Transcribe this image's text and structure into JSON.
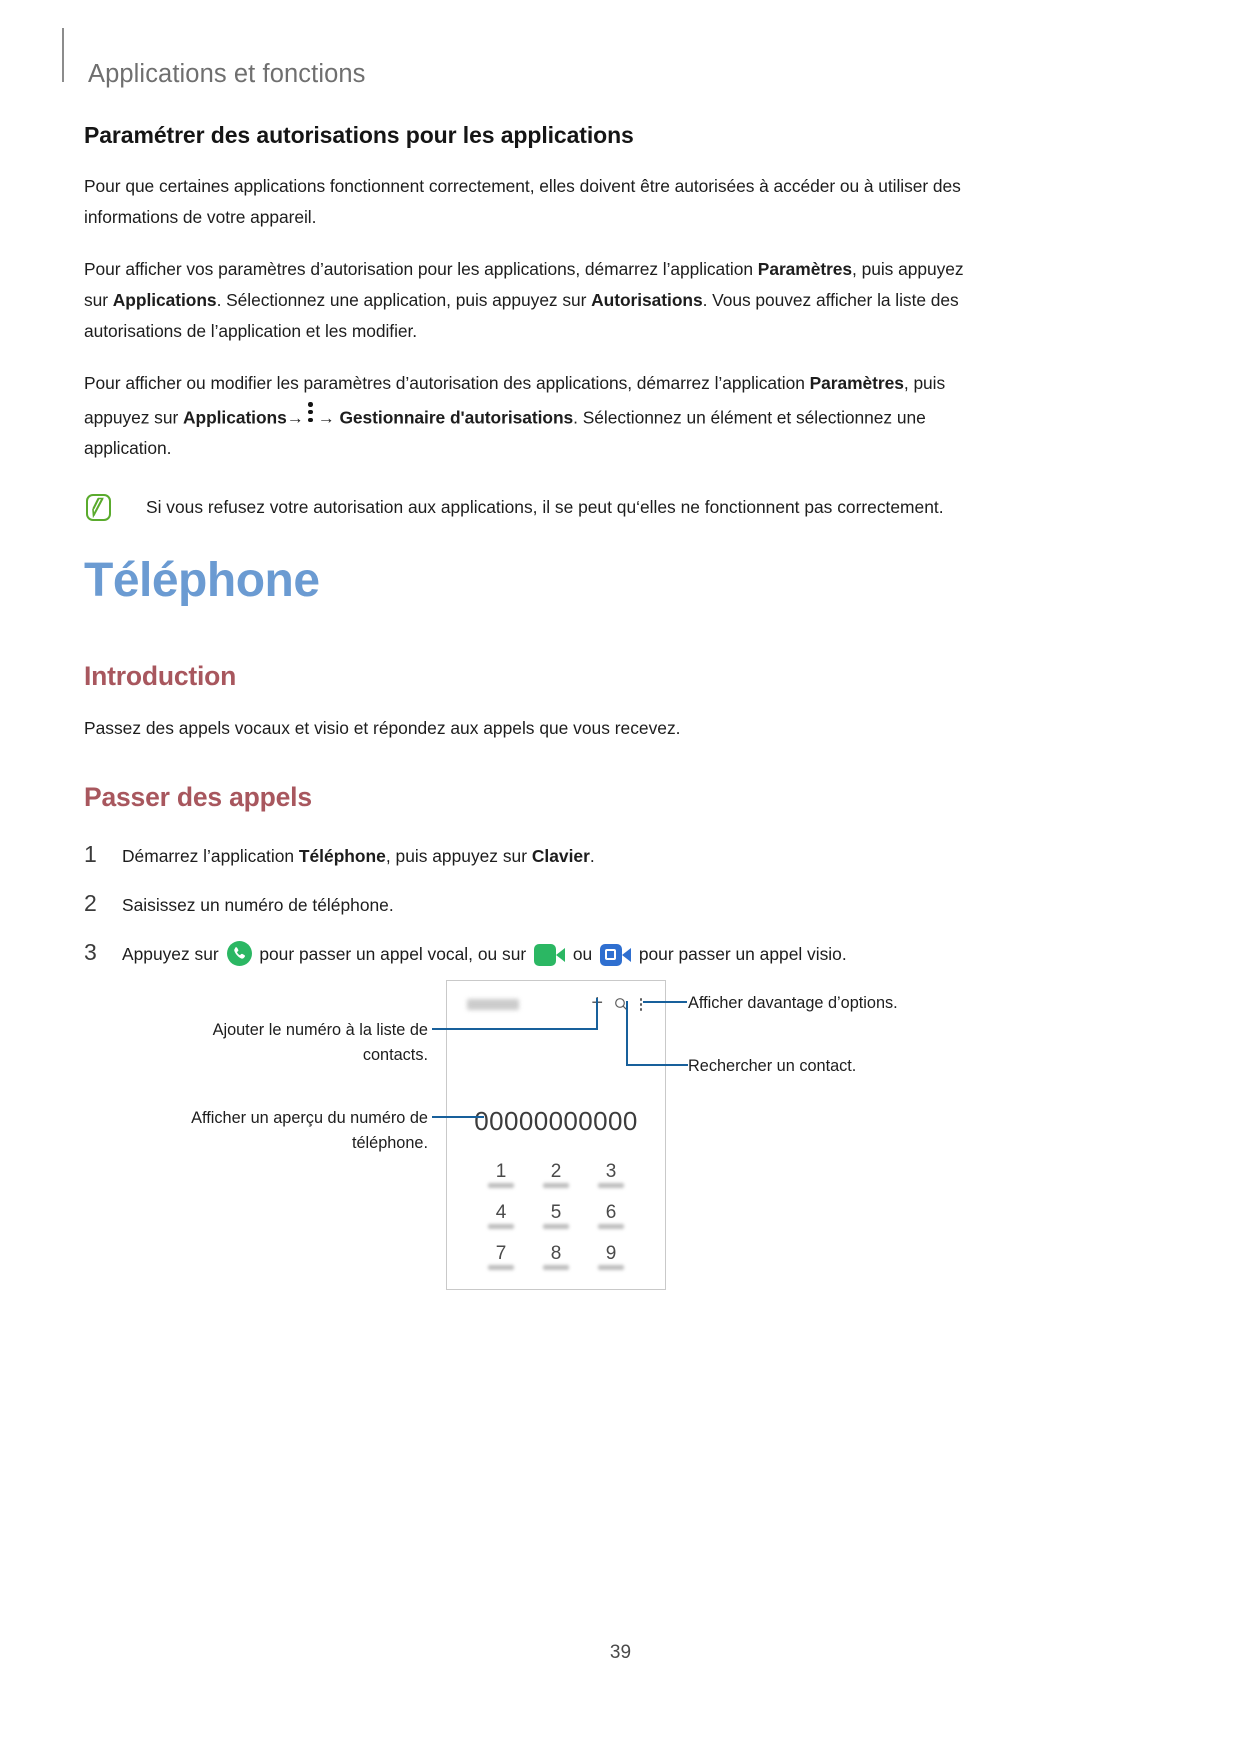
{
  "header": {
    "title": "Applications et fonctions"
  },
  "section": {
    "title": "Paramétrer des autorisations pour les applications",
    "p1": "Pour que certaines applications fonctionnent correctement, elles doivent être autorisées à accéder ou à utiliser des informations de votre appareil.",
    "p2_a": "Pour afficher vos paramètres d’autorisation pour les applications, démarrez l’application ",
    "p2_b1": "Paramètres",
    "p2_c": ", puis appuyez sur ",
    "p2_b2": "Applications",
    "p2_d": ". Sélectionnez une application, puis appuyez sur ",
    "p2_b3": "Autorisations",
    "p2_e": ". Vous pouvez afficher la liste des autorisations de l’application et les modifier.",
    "p3_a": "Pour afficher ou modifier les paramètres d’autorisation des applications, démarrez l’application ",
    "p3_b1": "Paramètres",
    "p3_c": ", puis appuyez sur ",
    "p3_b2": "Applications",
    "p3_arrow1": "→",
    "p3_arrow2": "→",
    "p3_b3": "Gestionnaire d'autorisations",
    "p3_d": ". Sélectionnez un élément et sélectionnez une application."
  },
  "note": {
    "icon": "note-pen-icon",
    "text": "Si vous refusez votre autorisation aux applications, il se peut qu‘elles ne fonctionnent pas correctement.",
    "accent_color": "#5aab2d"
  },
  "chapter": {
    "title": "Téléphone",
    "color": "#6b9bd2"
  },
  "introduction": {
    "heading": "Introduction",
    "text": "Passez des appels vocaux et visio et répondez aux appels que vous recevez.",
    "color": "#a8575e"
  },
  "passer_des_appels": {
    "heading": "Passer des appels",
    "steps": [
      {
        "num": "1",
        "a": "Démarrez l’application ",
        "b1": "Téléphone",
        "c": ", puis appuyez sur ",
        "b2": "Clavier",
        "d": "."
      },
      {
        "num": "2",
        "a": "Saisissez un numéro de téléphone.",
        "b1": "",
        "c": "",
        "b2": "",
        "d": ""
      },
      {
        "num": "3",
        "a": "Appuyez sur ",
        "mid1": " pour passer un appel vocal, ou sur ",
        "mid2": " ou ",
        "end": " pour passer un appel visio."
      }
    ]
  },
  "figure": {
    "phone": {
      "app_name": "Phone",
      "plus_icon": "plus-icon",
      "search_icon": "search-icon",
      "more_icon": "more-options-icon",
      "number": "00000000000",
      "keypad": [
        [
          {
            "digit": "1",
            "letters": ""
          },
          {
            "digit": "2",
            "letters": "ABC"
          },
          {
            "digit": "3",
            "letters": "DEF"
          }
        ],
        [
          {
            "digit": "4",
            "letters": "GHI"
          },
          {
            "digit": "5",
            "letters": "JKL"
          },
          {
            "digit": "6",
            "letters": "MNO"
          }
        ],
        [
          {
            "digit": "7",
            "letters": "PQRS"
          },
          {
            "digit": "8",
            "letters": "TUV"
          },
          {
            "digit": "9",
            "letters": "WXYZ"
          }
        ]
      ]
    },
    "callouts": {
      "add_contact_l1": "Ajouter le numéro à la liste de",
      "add_contact_l2": "contacts.",
      "preview_l1": "Afficher un aperçu du numéro de",
      "preview_l2": "téléphone.",
      "more_options": "Afficher davantage d’options.",
      "search_contact": "Rechercher un contact.",
      "leader_color": "#18609b"
    }
  },
  "footer": {
    "page_number": "39"
  },
  "icons": {
    "voice_call": "phone-call-icon",
    "video_call_green": "video-camera-icon",
    "video_call_blue": "video-camera-alt-icon"
  }
}
